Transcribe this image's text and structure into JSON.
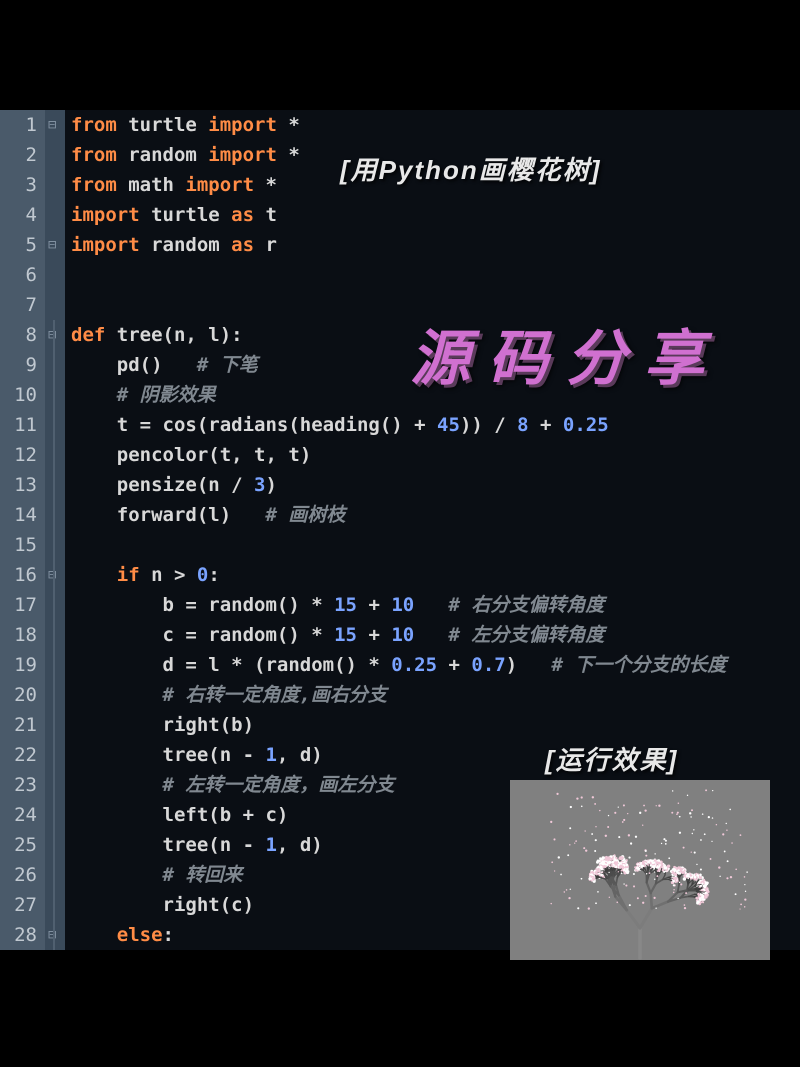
{
  "overlays": {
    "title": "[用Python画樱花树]",
    "share": "源码分享",
    "run_label": "[运行效果]"
  },
  "line_numbers": [
    "1",
    "2",
    "3",
    "4",
    "5",
    "6",
    "7",
    "8",
    "9",
    "10",
    "11",
    "12",
    "13",
    "14",
    "15",
    "16",
    "17",
    "18",
    "19",
    "20",
    "21",
    "22",
    "23",
    "24",
    "25",
    "26",
    "27",
    "28"
  ],
  "code_lines": [
    {
      "t": [
        [
          "kw",
          "from "
        ],
        [
          "id",
          "turtle "
        ],
        [
          "kw",
          "import "
        ],
        [
          "op",
          "*"
        ]
      ]
    },
    {
      "t": [
        [
          "kw",
          "from "
        ],
        [
          "id",
          "random "
        ],
        [
          "kw",
          "import "
        ],
        [
          "op",
          "*"
        ]
      ]
    },
    {
      "t": [
        [
          "kw",
          "from "
        ],
        [
          "id",
          "math "
        ],
        [
          "kw",
          "import "
        ],
        [
          "op",
          "*"
        ]
      ]
    },
    {
      "t": [
        [
          "kw",
          "import "
        ],
        [
          "id",
          "turtle "
        ],
        [
          "kw",
          "as "
        ],
        [
          "id",
          "t"
        ]
      ]
    },
    {
      "t": [
        [
          "kw",
          "import "
        ],
        [
          "id",
          "random "
        ],
        [
          "kw",
          "as "
        ],
        [
          "id",
          "r"
        ]
      ]
    },
    {
      "t": []
    },
    {
      "t": []
    },
    {
      "t": [
        [
          "kw",
          "def "
        ],
        [
          "fn",
          "tree(n"
        ],
        [
          "op",
          ", "
        ],
        [
          "id",
          "l):"
        ]
      ]
    },
    {
      "t": [
        [
          "id",
          "    pd()   "
        ],
        [
          "cm",
          "# 下笔"
        ]
      ]
    },
    {
      "t": [
        [
          "id",
          "    "
        ],
        [
          "cm",
          "# 阴影效果"
        ]
      ]
    },
    {
      "t": [
        [
          "id",
          "    t = cos(radians(heading() + "
        ],
        [
          "num",
          "45"
        ],
        [
          "id",
          ")) / "
        ],
        [
          "num",
          "8"
        ],
        [
          "id",
          " + "
        ],
        [
          "num",
          "0.25"
        ]
      ]
    },
    {
      "t": [
        [
          "id",
          "    pencolor(t"
        ],
        [
          "op",
          ", "
        ],
        [
          "id",
          "t"
        ],
        [
          "op",
          ", "
        ],
        [
          "id",
          "t)"
        ]
      ]
    },
    {
      "t": [
        [
          "id",
          "    pensize(n / "
        ],
        [
          "num",
          "3"
        ],
        [
          "id",
          ")"
        ]
      ]
    },
    {
      "t": [
        [
          "id",
          "    forward(l)   "
        ],
        [
          "cm",
          "# 画树枝"
        ]
      ]
    },
    {
      "t": []
    },
    {
      "t": [
        [
          "id",
          "    "
        ],
        [
          "kw",
          "if "
        ],
        [
          "id",
          "n > "
        ],
        [
          "num",
          "0"
        ],
        [
          "id",
          ":"
        ]
      ]
    },
    {
      "t": [
        [
          "id",
          "        b = random() * "
        ],
        [
          "num",
          "15"
        ],
        [
          "id",
          " + "
        ],
        [
          "num",
          "10"
        ],
        [
          "id",
          "   "
        ],
        [
          "cm",
          "# 右分支偏转角度"
        ]
      ]
    },
    {
      "t": [
        [
          "id",
          "        c = random() * "
        ],
        [
          "num",
          "15"
        ],
        [
          "id",
          " + "
        ],
        [
          "num",
          "10"
        ],
        [
          "id",
          "   "
        ],
        [
          "cm",
          "# 左分支偏转角度"
        ]
      ]
    },
    {
      "t": [
        [
          "id",
          "        d = l * (random() * "
        ],
        [
          "num",
          "0.25"
        ],
        [
          "id",
          " + "
        ],
        [
          "num",
          "0.7"
        ],
        [
          "id",
          ")   "
        ],
        [
          "cm",
          "# 下一个分支的长度"
        ]
      ]
    },
    {
      "t": [
        [
          "id",
          "        "
        ],
        [
          "cm",
          "# 右转一定角度,画右分支"
        ]
      ]
    },
    {
      "t": [
        [
          "id",
          "        right(b)"
        ]
      ]
    },
    {
      "t": [
        [
          "id",
          "        tree(n - "
        ],
        [
          "num",
          "1"
        ],
        [
          "op",
          ", "
        ],
        [
          "id",
          "d)"
        ]
      ]
    },
    {
      "t": [
        [
          "id",
          "        "
        ],
        [
          "cm",
          "# 左转一定角度，画左分支"
        ]
      ]
    },
    {
      "t": [
        [
          "id",
          "        left(b + c)"
        ]
      ]
    },
    {
      "t": [
        [
          "id",
          "        tree(n - "
        ],
        [
          "num",
          "1"
        ],
        [
          "op",
          ", "
        ],
        [
          "id",
          "d)"
        ]
      ]
    },
    {
      "t": [
        [
          "id",
          "        "
        ],
        [
          "cm",
          "# 转回来"
        ]
      ]
    },
    {
      "t": [
        [
          "id",
          "        right(c)"
        ]
      ]
    },
    {
      "t": [
        [
          "id",
          "    "
        ],
        [
          "kw",
          "else"
        ],
        [
          "id",
          ":"
        ]
      ]
    }
  ],
  "fold_marks": [
    {
      "line": 1,
      "char": "⊟"
    },
    {
      "line": 5,
      "char": "⊟"
    },
    {
      "line": 8,
      "char": "⊟"
    },
    {
      "line": 16,
      "char": "⊟"
    },
    {
      "line": 28,
      "char": "⊟"
    }
  ]
}
